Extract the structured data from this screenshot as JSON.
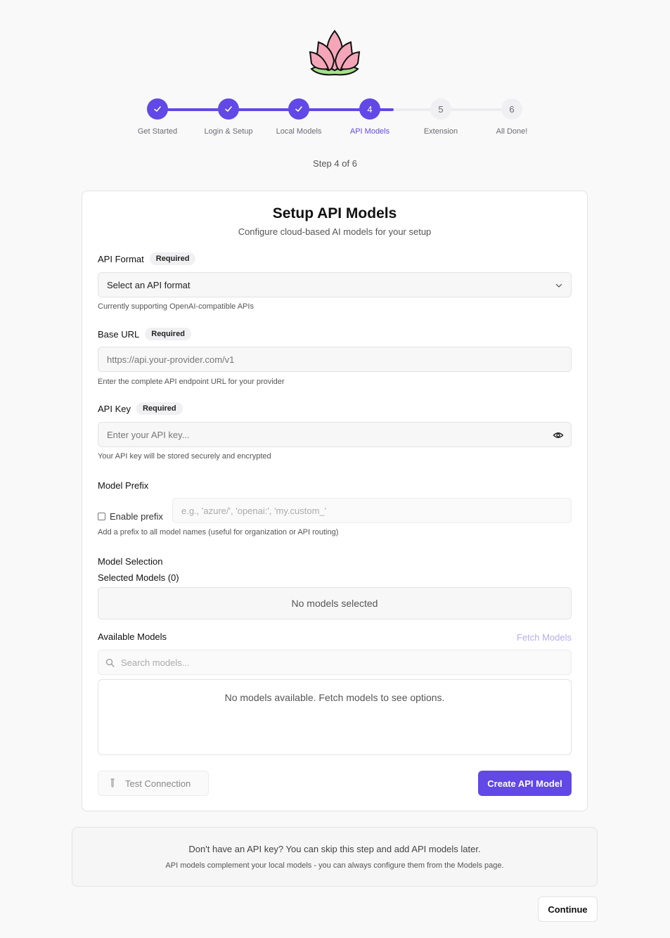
{
  "logo": {
    "icon": "lotus-icon",
    "petal_color": "#f4a6b8",
    "leaf_color": "#a5e08a"
  },
  "stepper": {
    "accent_color": "#6248e6",
    "steps": [
      {
        "number": "1",
        "label": "Get Started",
        "status": "done"
      },
      {
        "number": "2",
        "label": "Login & Setup",
        "status": "done"
      },
      {
        "number": "3",
        "label": "Local Models",
        "status": "done"
      },
      {
        "number": "4",
        "label": "API Models",
        "status": "active"
      },
      {
        "number": "5",
        "label": "Extension",
        "status": "todo"
      },
      {
        "number": "6",
        "label": "All Done!",
        "status": "todo"
      }
    ],
    "step_count": "Step 4 of 6"
  },
  "card": {
    "title": "Setup API Models",
    "subtitle": "Configure cloud-based AI models for your setup",
    "api_format": {
      "label": "API Format",
      "badge": "Required",
      "value": "Select an API format",
      "help": "Currently supporting OpenAI-compatible APIs"
    },
    "base_url": {
      "label": "Base URL",
      "badge": "Required",
      "placeholder": "https://api.your-provider.com/v1",
      "help": "Enter the complete API endpoint URL for your provider"
    },
    "api_key": {
      "label": "API Key",
      "badge": "Required",
      "placeholder": "Enter your API key...",
      "help": "Your API key will be stored securely and encrypted"
    },
    "model_prefix": {
      "label": "Model Prefix",
      "checkbox_label": "Enable prefix",
      "checked": false,
      "placeholder": "e.g., 'azure/', 'openai:', 'my.custom_'",
      "help": "Add a prefix to all model names (useful for organization or API routing)"
    },
    "model_selection": {
      "label": "Model Selection",
      "selected_label": "Selected Models (0)",
      "selected_empty": "No models selected",
      "available_label": "Available Models",
      "fetch_label": "Fetch Models",
      "search_placeholder": "Search models...",
      "available_empty": "No models available. Fetch models to see options."
    },
    "test_button": "Test Connection",
    "create_button": "Create API Model"
  },
  "note": {
    "line1": "Don't have an API key? You can skip this step and add API models later.",
    "line2": "API models complement your local models - you can always configure them from the Models page."
  },
  "continue_button": "Continue"
}
